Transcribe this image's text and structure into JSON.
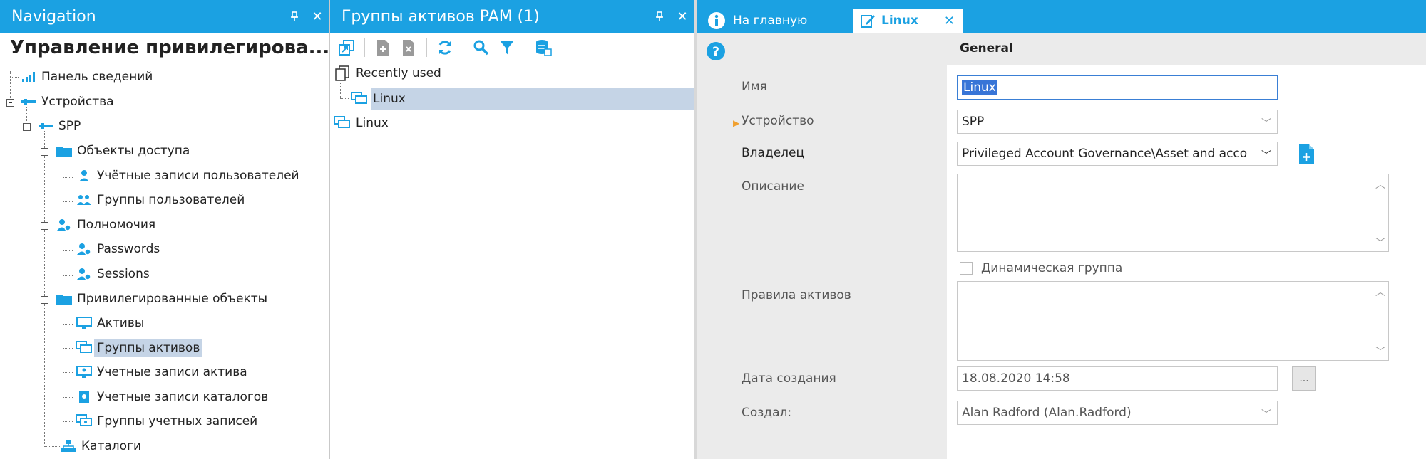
{
  "navigation": {
    "title": "Navigation",
    "heading": "Управление привилегирова...",
    "tree": {
      "dashboard": "Панель сведений",
      "devices": "Устройства",
      "spp": "SPP",
      "access_objects": "Объекты доступа",
      "user_accounts": "Учётные записи пользователей",
      "user_groups": "Группы пользователей",
      "permissions": "Полномочия",
      "passwords": "Passwords",
      "sessions": "Sessions",
      "privileged_objects": "Привилегированные объекты",
      "assets": "Активы",
      "asset_groups": "Группы активов",
      "asset_accounts": "Учетные записи актива",
      "directory_accounts": "Учетные записи каталогов",
      "account_groups": "Группы учетных записей",
      "directories": "Каталоги"
    }
  },
  "middle": {
    "title": "Группы активов PAM (1)",
    "recently_used": "Recently used",
    "recent_item": "Linux",
    "item": "Linux"
  },
  "detail": {
    "tabs": {
      "home": "На главную",
      "active": "Linux"
    },
    "section": "General",
    "labels": {
      "name": "Имя",
      "device": "Устройство",
      "owner": "Владелец",
      "description": "Описание",
      "dynamic_group": "Динамическая группа",
      "asset_rules": "Правила активов",
      "created_date": "Дата создания",
      "created_by": "Создал:"
    },
    "values": {
      "name": "Linux",
      "device": "SPP",
      "owner": "Privileged Account Governance\\Asset and acco",
      "created_date": "18.08.2020 14:58",
      "created_by": "Alan Radford (Alan.Radford)",
      "ellipsis_button": "..."
    }
  },
  "colors": {
    "accent": "#1ba1e2",
    "selection": "#c5d4e6"
  }
}
